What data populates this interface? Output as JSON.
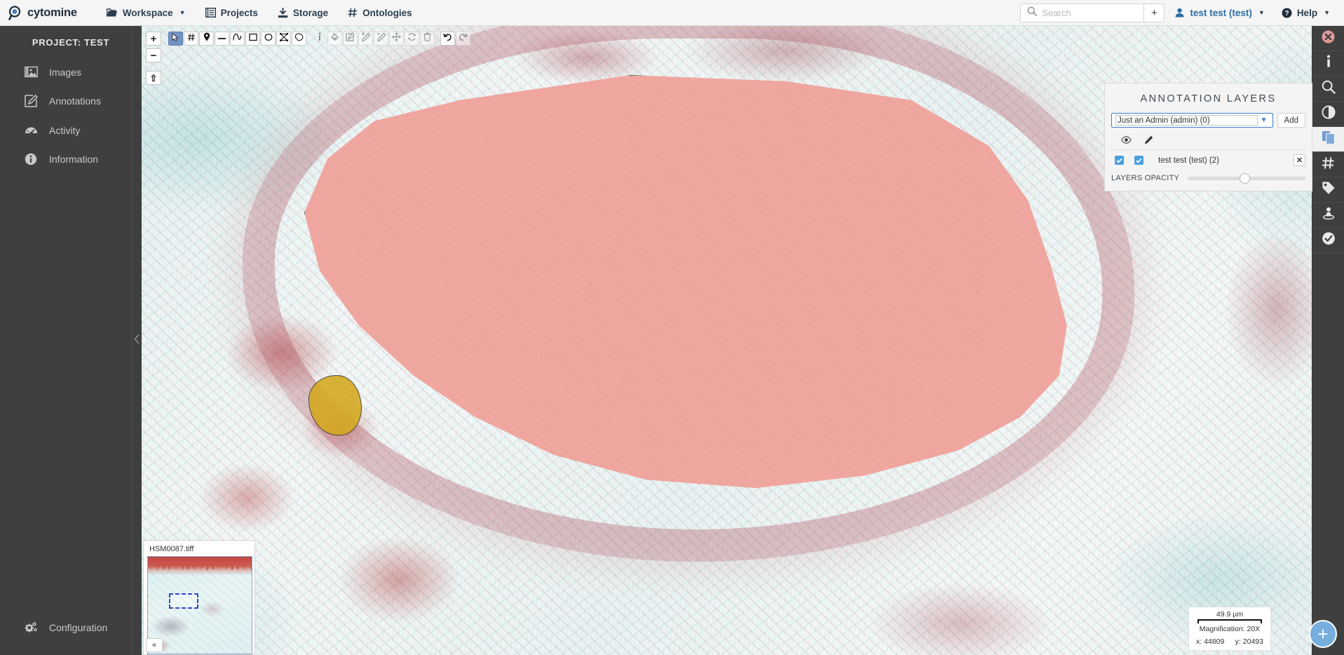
{
  "navbar": {
    "brand": "cytomine",
    "brand_icon": "magnifier-logo-icon",
    "items": [
      {
        "label": "Workspace",
        "icon": "folder-icon",
        "has_caret": true
      },
      {
        "label": "Projects",
        "icon": "list-icon",
        "has_caret": false
      },
      {
        "label": "Storage",
        "icon": "download-tray-icon",
        "has_caret": false
      },
      {
        "label": "Ontologies",
        "icon": "hash-icon",
        "has_caret": false
      }
    ],
    "search": {
      "placeholder": "Search",
      "value": "",
      "add_label": "+"
    },
    "user": "test test (test)",
    "help": "Help"
  },
  "sidebar": {
    "project_title": "PROJECT: TEST",
    "items": [
      {
        "label": "Images",
        "icon": "images-icon"
      },
      {
        "label": "Annotations",
        "icon": "annotation-edit-icon"
      },
      {
        "label": "Activity",
        "icon": "gauge-icon"
      },
      {
        "label": "Information",
        "icon": "info-circle-icon"
      }
    ],
    "bottom": {
      "label": "Configuration",
      "icon": "gears-icon"
    }
  },
  "viewer": {
    "zoom_controls": [
      {
        "name": "zoom-in-button",
        "glyph": "+"
      },
      {
        "name": "zoom-out-button",
        "glyph": "−"
      },
      {
        "name": "home-reset-button",
        "glyph": "⇧"
      }
    ],
    "tools": [
      {
        "name": "select-tool",
        "icon": "cursor-arrow-icon",
        "active": true,
        "state": "normal"
      },
      {
        "name": "grid-tool",
        "icon": "hash-icon",
        "active": false,
        "state": "normal"
      },
      {
        "name": "point-tool",
        "icon": "map-pin-icon",
        "active": false,
        "state": "normal"
      },
      {
        "name": "line-tool",
        "icon": "minus-line-icon",
        "active": false,
        "state": "normal"
      },
      {
        "name": "freehand-line-tool",
        "icon": "squiggle-icon",
        "active": false,
        "state": "normal"
      },
      {
        "name": "rectangle-tool",
        "icon": "square-icon",
        "active": false,
        "state": "normal"
      },
      {
        "name": "ellipse-tool",
        "icon": "circle-icon",
        "active": false,
        "state": "normal"
      },
      {
        "name": "polygon-tool",
        "icon": "polygon-icon",
        "active": false,
        "state": "normal"
      },
      {
        "name": "freehand-polygon-tool",
        "icon": "blob-shape-icon",
        "active": false,
        "state": "normal"
      },
      {
        "name": "info-tool",
        "icon": "info-i-icon",
        "active": false,
        "state": "plain"
      },
      {
        "name": "fill-tool",
        "icon": "paint-bucket-icon",
        "active": false,
        "state": "ghost"
      },
      {
        "name": "edit-annotation-tool",
        "icon": "edit-box-icon",
        "active": false,
        "state": "ghost"
      },
      {
        "name": "add-part-tool",
        "icon": "pencil-plus-icon",
        "active": false,
        "state": "ghost"
      },
      {
        "name": "remove-part-tool",
        "icon": "pencil-minus-icon",
        "active": false,
        "state": "ghost"
      },
      {
        "name": "move-tool",
        "icon": "move-arrows-icon",
        "active": false,
        "state": "ghost"
      },
      {
        "name": "rotate-tool",
        "icon": "refresh-icon",
        "active": false,
        "state": "ghost"
      },
      {
        "name": "delete-tool",
        "icon": "trash-icon",
        "active": false,
        "state": "ghost"
      },
      {
        "name": "undo-button",
        "icon": "undo-arrow-icon",
        "active": false,
        "state": "normal"
      },
      {
        "name": "redo-button",
        "icon": "redo-arrow-icon",
        "active": false,
        "state": "ghost"
      }
    ],
    "annotations": [
      {
        "name": "large-vessel-annotation",
        "color": "#ef9d94"
      },
      {
        "name": "small-yellow-annotation",
        "color": "#d4a81e"
      }
    ]
  },
  "layers_panel": {
    "title": "ANNOTATION LAYERS",
    "select_value": "Just an Admin (admin) (0)",
    "add_label": "Add",
    "columns": {
      "visible_icon": "eye-icon",
      "draw_icon": "pencil-icon"
    },
    "layers": [
      {
        "name": "test test (test) (2)",
        "visible": true,
        "drawable": true,
        "remove_label": "✕"
      }
    ],
    "opacity_label": "LAYERS OPACITY",
    "opacity_value": 48
  },
  "rail": {
    "items": [
      {
        "name": "close-panel-button",
        "icon": "close-circle-icon",
        "active": false
      },
      {
        "name": "image-information-button",
        "icon": "info-i-icon",
        "active": false
      },
      {
        "name": "search-button",
        "icon": "magnifier-icon",
        "active": false
      },
      {
        "name": "contrast-button",
        "icon": "contrast-circle-icon",
        "active": false
      },
      {
        "name": "annotation-layers-button",
        "icon": "layers-copy-icon",
        "active": true
      },
      {
        "name": "ontology-button",
        "icon": "hash-icon",
        "active": false
      },
      {
        "name": "properties-button",
        "icon": "tag-icon",
        "active": false
      },
      {
        "name": "review-button",
        "icon": "person-pin-icon",
        "active": false
      },
      {
        "name": "validate-button",
        "icon": "check-circle-icon",
        "active": false
      }
    ]
  },
  "minimap": {
    "filename": "HSM0087.tiff",
    "collapse_label": "«"
  },
  "scalebox": {
    "scale": "49.9 µm",
    "magnification": "Magnification: 20X",
    "x_label": "x: 44809",
    "y_label": "y: 20493"
  },
  "fab": {
    "label": "+",
    "name": "add-action-button"
  }
}
